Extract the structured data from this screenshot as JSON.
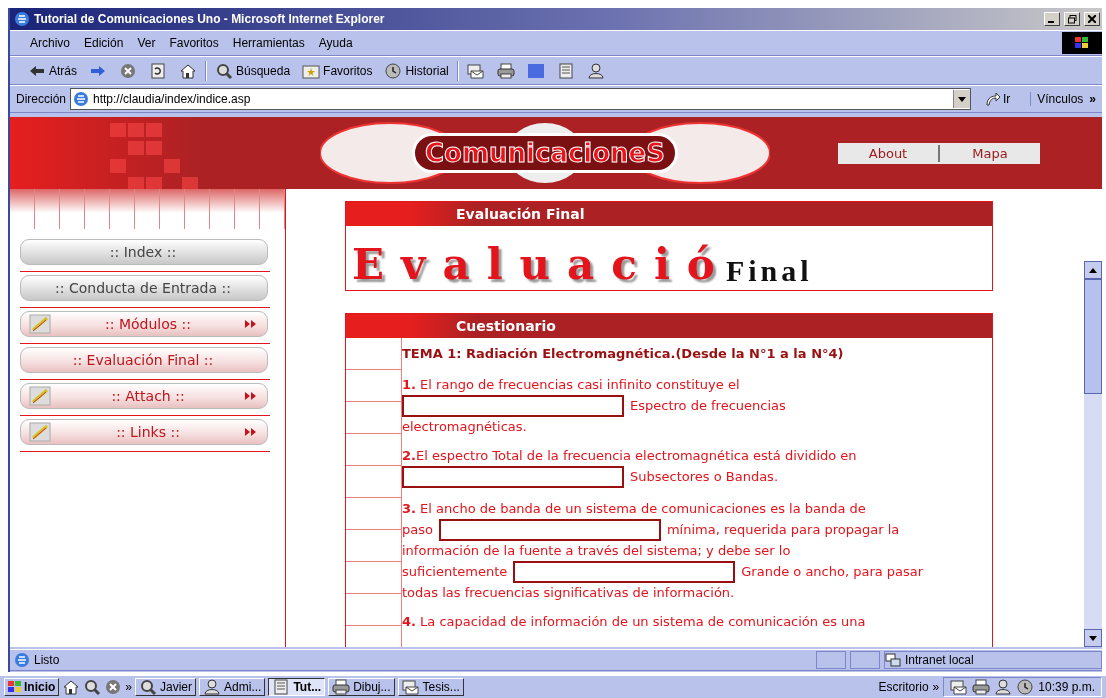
{
  "window": {
    "title": "Tutorial de Comunicaciones Uno - Microsoft Internet Explorer"
  },
  "menu": [
    "Archivo",
    "Edición",
    "Ver",
    "Favoritos",
    "Herramientas",
    "Ayuda"
  ],
  "toolbar": [
    {
      "kind": "back",
      "label": "Atrás"
    },
    {
      "kind": "forward"
    },
    {
      "kind": "stop"
    },
    {
      "kind": "refresh"
    },
    {
      "kind": "home"
    },
    {
      "kind": "search",
      "label": "Búsqueda"
    },
    {
      "kind": "favorites",
      "label": "Favoritos"
    },
    {
      "kind": "history",
      "label": "Historial"
    },
    {
      "kind": "mail"
    },
    {
      "kind": "print"
    },
    {
      "kind": "color"
    },
    {
      "kind": "edit"
    },
    {
      "kind": "messenger"
    }
  ],
  "address": {
    "label": "Dirección",
    "value": "http://claudia/index/indice.asp",
    "go": "Ir",
    "links": "Vínculos",
    "more": "»"
  },
  "site": {
    "logo": "ComunicacioneS",
    "top_links": [
      "About",
      "Mapa"
    ],
    "nav": [
      {
        "label": ":: Index ::",
        "kind": "plain"
      },
      {
        "label": ":: Conducta de Entrada ::",
        "kind": "plain"
      },
      {
        "label": ":: Módulos ::",
        "kind": "submenu"
      },
      {
        "label": ":: Evaluación Final ::",
        "kind": "tinted"
      },
      {
        "label": ":: Attach ::",
        "kind": "submenu"
      },
      {
        "label": ":: Links ::",
        "kind": "submenu"
      }
    ],
    "panels": [
      {
        "title": "Evaluación Final",
        "banner": "Evaluació",
        "banner_overlay": "Final"
      },
      {
        "title": "Cuestionario",
        "heading": "TEMA 1: Radiación Electromagnética.(Desde la N°1 a la N°4)",
        "questions": [
          {
            "lines": [
              [
                {
                  "kind": "text",
                  "text": "**1.** El rango de frecuencias casi infinito constituye el"
                }
              ],
              [
                {
                  "kind": "blank"
                },
                {
                  "kind": "text",
                  "text": "Espectro de frecuencias"
                }
              ],
              [
                {
                  "kind": "text",
                  "text": "electromagnéticas."
                }
              ]
            ]
          },
          {
            "lines": [
              [
                {
                  "kind": "text",
                  "text": "**2.**El espectro Total de la frecuencia electromagnética está dividido en"
                }
              ],
              [
                {
                  "kind": "blank"
                },
                {
                  "kind": "text",
                  "text": "Subsectores o Bandas."
                }
              ]
            ]
          },
          {
            "lines": [
              [
                {
                  "kind": "text",
                  "text": "**3.** El ancho de banda de un sistema de comunicaciones es la banda de"
                }
              ],
              [
                {
                  "kind": "text",
                  "text": "paso"
                },
                {
                  "kind": "blank"
                },
                {
                  "kind": "text",
                  "text": "mínima, requerida para propagar la"
                }
              ],
              [
                {
                  "kind": "text",
                  "text": "información de la fuente a través del sistema; y debe ser lo"
                }
              ],
              [
                {
                  "kind": "text",
                  "text": "suficientemente"
                },
                {
                  "kind": "blank"
                },
                {
                  "kind": "text",
                  "text": "Grande o ancho, para pasar"
                }
              ],
              [
                {
                  "kind": "text",
                  "text": "todas las frecuencias significativas de información."
                }
              ]
            ]
          },
          {
            "lines": [
              [
                {
                  "kind": "text",
                  "text": "**4.** La capacidad de información de un sistema de comunicación es una"
                }
              ]
            ]
          }
        ]
      }
    ]
  },
  "status_bar": {
    "text": "Listo",
    "zone": "Intranet local"
  },
  "taskbar": {
    "start": "Inicio",
    "quick_more": "»",
    "items": [
      {
        "label": "Javier",
        "selected": false
      },
      {
        "label": "Admi...",
        "selected": false
      },
      {
        "label": "Tut...",
        "selected": true
      },
      {
        "label": "Dibuj...",
        "selected": false
      },
      {
        "label": "Tesis...",
        "selected": false
      }
    ],
    "desktop": "Escritorio",
    "desktop_more": "»",
    "clock": "10:39 p.m."
  }
}
